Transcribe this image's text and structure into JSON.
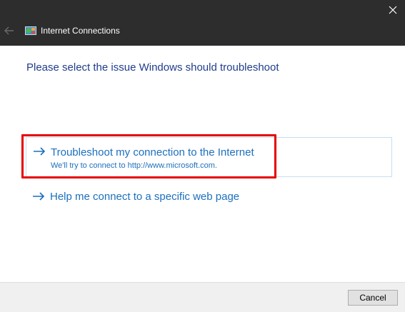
{
  "window": {
    "title": "Internet Connections",
    "close_icon": "close-icon",
    "back_icon": "back-arrow-icon",
    "app_icon": "internet-connections-icon"
  },
  "main": {
    "instruction": "Please select the issue Windows should troubleshoot",
    "options": [
      {
        "title": "Troubleshoot my connection to the Internet",
        "description": "We'll try to connect to http://www.microsoft.com.",
        "icon": "arrow-right-icon",
        "highlighted": true
      },
      {
        "title": "Help me connect to a specific web page",
        "icon": "arrow-right-icon",
        "highlighted": false
      }
    ]
  },
  "footer": {
    "cancel_label": "Cancel"
  },
  "colors": {
    "titlebar": "#2d2d2d",
    "instruction_text": "#1f3d8c",
    "link_text": "#1c6fbd",
    "highlight": "#e60000"
  }
}
